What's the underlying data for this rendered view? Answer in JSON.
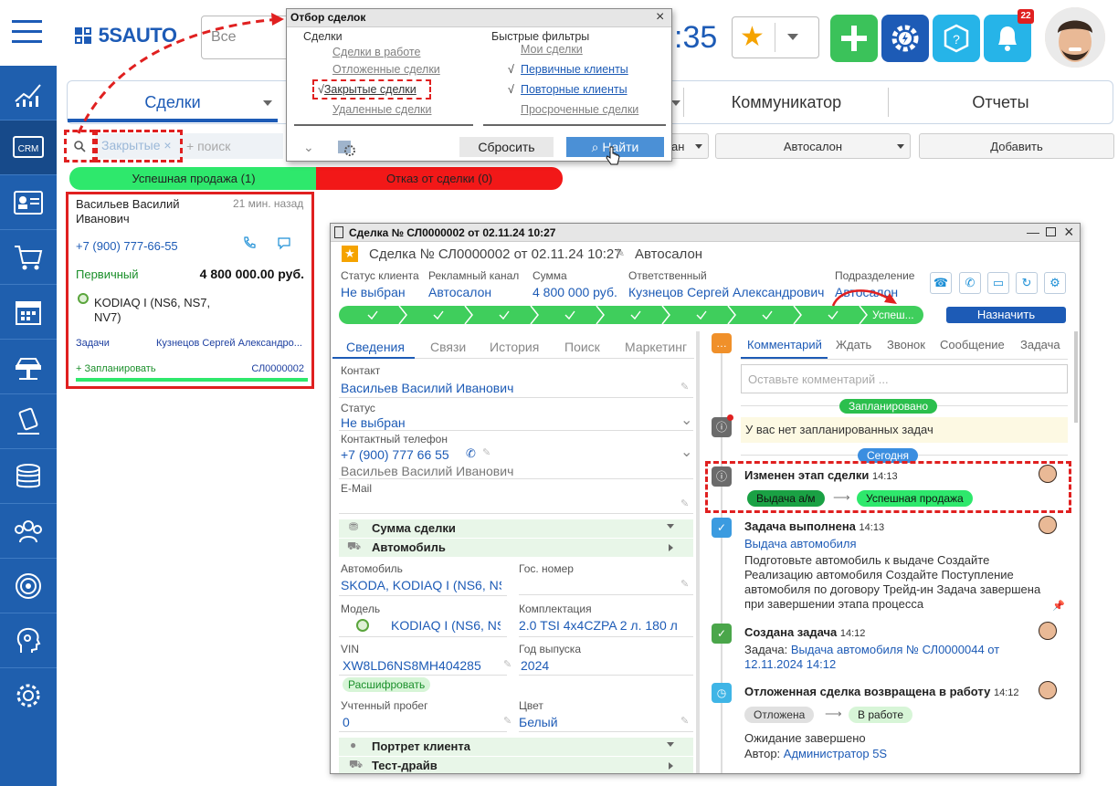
{
  "header": {
    "logo": "5SAUTO",
    "search_value": "Все",
    "clock": ":35",
    "notifications_count": "22"
  },
  "tabs": [
    {
      "label": "Сделки"
    },
    {
      "label": "Коммуникатор"
    },
    {
      "label": "Отчеты"
    }
  ],
  "filter_bar": {
    "chip": "Закрытые",
    "placeholder": "+ поиск",
    "dropdown1_partial": "ан",
    "dropdown2": "Автосалон",
    "add_button": "Добавить"
  },
  "status_columns": [
    {
      "label": "Успешная продажа (1)",
      "color": "#2ee86c"
    },
    {
      "label": "Отказ от сделки (0)",
      "color": "#f21818"
    }
  ],
  "deal_card": {
    "name": "Васильев Василий Иванович",
    "time_ago": "21 мин. назад",
    "phone": "+7 (900) 777-66-55",
    "client_type": "Первичный",
    "amount": "4 800 000.00 руб.",
    "car": "KODIAQ I (NS6, NS7, NV7)",
    "tasks_label": "Задачи",
    "manager": "Кузнецов Сергей Александро...",
    "plan_link": "+ Запланировать",
    "deal_code": "СЛ0000002"
  },
  "filter_popup": {
    "title": "Отбор сделок",
    "col1_header": "Сделки",
    "col1_items": [
      "Сделки в работе",
      "Отложенные сделки",
      "Закрытые сделки",
      "Удаленные сделки"
    ],
    "col1_checked": "√",
    "col2_header": "Быстрые фильтры",
    "col2_items": [
      "Мои сделки",
      "Первичные клиенты",
      "Повторные клиенты",
      "Просроченные сделки"
    ],
    "col2_check1": "√",
    "col2_check2": "√",
    "reset_button": "Сбросить",
    "find_button": "Найти"
  },
  "deal_window": {
    "window_title": "Сделка № СЛ0000002 от 02.11.24 10:27",
    "header_title": "Сделка № СЛ0000002 от 02.11.24 10:27",
    "header_org": "Автосалон",
    "fields": [
      {
        "label": "Статус клиента",
        "value": "Не выбран"
      },
      {
        "label": "Рекламный канал",
        "value": "Автосалон"
      },
      {
        "label": "Сумма",
        "value": "4 800 000 руб."
      },
      {
        "label": "Ответственный",
        "value": "Кузнецов Сергей Александрович"
      },
      {
        "label": "Подразделение",
        "value": "Автосалон"
      }
    ],
    "stage_current": "Успеш...",
    "assign_button": "Назначить",
    "left_tabs": [
      "Сведения",
      "Связи",
      "История",
      "Поиск",
      "Маркетинг"
    ],
    "contact_label": "Контакт",
    "contact_value": "Васильев Василий Иванович",
    "status_label": "Статус",
    "status_value": "Не выбран",
    "phone_label": "Контактный телефон",
    "phone_value": "+7 (900) 777 66 55",
    "phone_owner": "Васильев Василий Иванович",
    "email_label": "E-Mail",
    "sections": [
      "Сумма сделки",
      "Автомобиль"
    ],
    "car_label": "Автомобиль",
    "car_value": "SKODA, KODIAQ I (NS6, NS",
    "gos_label": "Гос. номер",
    "model_label": "Модель",
    "model_value": "KODIAQ I (NS6, NS",
    "kompl_label": "Комплектация",
    "kompl_value": "2.0 TSI 4x4CZPA 2 л. 180 л",
    "vin_label": "VIN",
    "vin_value": "XW8LD6NS8MH404285",
    "year_label": "Год выпуска",
    "year_value": "2024",
    "decode_button": "Расшифровать",
    "mileage_label": "Учтенный пробег",
    "mileage_value": "0",
    "color_label": "Цвет",
    "color_value": "Белый",
    "sections2": [
      "Портрет клиента",
      "Тест-драйв"
    ],
    "right_tabs": [
      "Комментарий",
      "Ждать",
      "Звонок",
      "Сообщение",
      "Задача"
    ],
    "comment_placeholder": "Оставьте комментарий ...",
    "planned_badge": "Запланировано",
    "no_tasks": "У вас нет запланированных задач",
    "today_badge": "Сегодня",
    "events": [
      {
        "title": "Изменен этап сделки",
        "time": "14:13",
        "from": "Выдача а/м",
        "to": "Успешная продажа"
      },
      {
        "title": "Задача выполнена",
        "time": "14:13",
        "link": "Выдача автомобиля",
        "text": "Подготовьте автомобиль к выдаче Создайте Реализацию автомобиля Создайте Поступление автомобиля по договору Трейд-ин Задача завершена при завершении этапа процесса"
      },
      {
        "title": "Создана задача",
        "time": "14:12",
        "prefix": "Задача:",
        "link": "Выдача автомобиля № СЛ0000044 от 12.11.2024 14:12"
      },
      {
        "title": "Отложенная сделка возвращена в работу",
        "time": "14:12",
        "from": "Отложена",
        "to": "В работе",
        "line1": "Ожидание завершено",
        "author_label": "Автор:",
        "author": "Администратор 5S"
      }
    ]
  }
}
